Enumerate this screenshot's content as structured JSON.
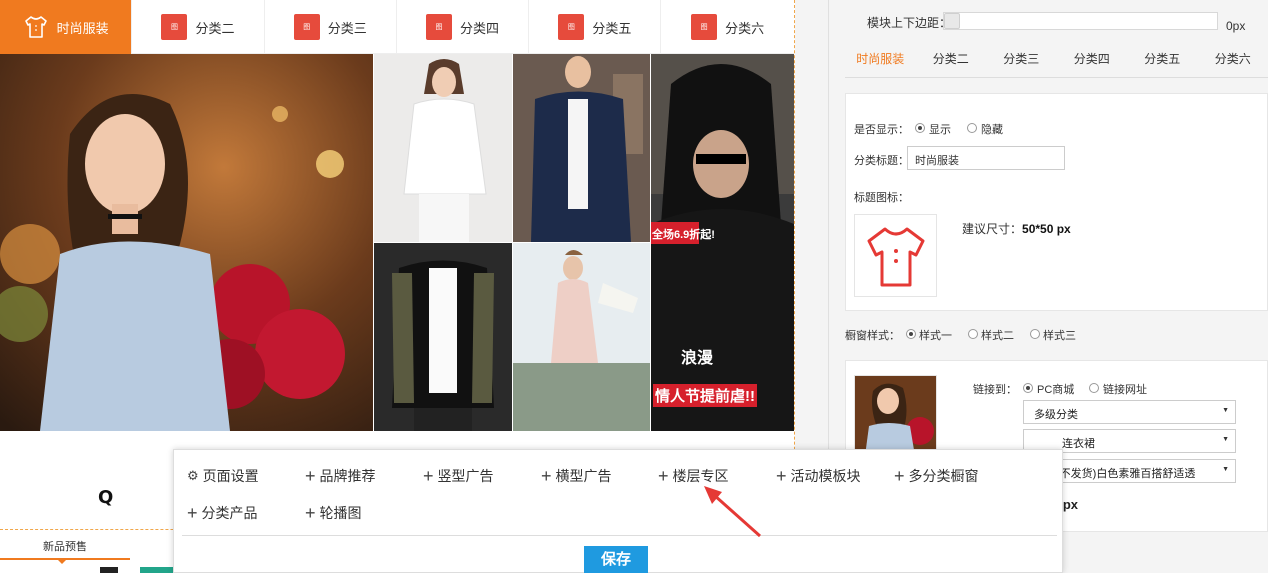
{
  "preview": {
    "tabs": [
      {
        "label": "时尚服装",
        "active": true
      },
      {
        "label": "分类二",
        "icon_text": "图"
      },
      {
        "label": "分类三",
        "icon_text": "图"
      },
      {
        "label": "分类四",
        "icon_text": "图"
      },
      {
        "label": "分类五",
        "icon_text": "图"
      },
      {
        "label": "分类六",
        "icon_text": "图"
      }
    ],
    "promo_banner": "全场6.9折起!",
    "banner_line1": "浪漫",
    "banner_line2": "情人节提前虐!!",
    "brand_partial": "Q",
    "new_arrival_tab": "新品预售"
  },
  "panel": {
    "margin_label": "模块上下边距：",
    "margin_value": "0px",
    "tabs": [
      "时尚服装",
      "分类二",
      "分类三",
      "分类四",
      "分类五",
      "分类六"
    ],
    "show_label": "是否显示：",
    "show_options": [
      "显示",
      "隐藏"
    ],
    "title_label": "分类标题：",
    "title_value": "时尚服装",
    "icon_label": "标题图标：",
    "size_hint_label": "建议尺寸：",
    "size_hint_value": "50*50 px",
    "window_style_label": "橱窗样式：",
    "window_styles": [
      "样式一",
      "样式二",
      "样式三"
    ],
    "link_label": "链接到：",
    "link_options": [
      "PC商城",
      "链接网址"
    ],
    "select_category": "多级分类",
    "select_subcategory": "连衣裙",
    "select_product": "(后台不发货)白色素雅百搭舒适透",
    "size_px": "0 px"
  },
  "popup": {
    "items_row1": [
      "页面设置",
      "品牌推荐",
      "竖型广告",
      "横型广告",
      "楼层专区",
      "活动模板块",
      "多分类橱窗"
    ],
    "items_row2": [
      "分类产品",
      "轮播图"
    ],
    "save_label": "保存"
  },
  "colors": {
    "accent_orange": "#f07a1f",
    "tab_icon_red": "#e64b3c",
    "save_blue": "#1f9ae0",
    "arrow_red": "#e53935"
  }
}
